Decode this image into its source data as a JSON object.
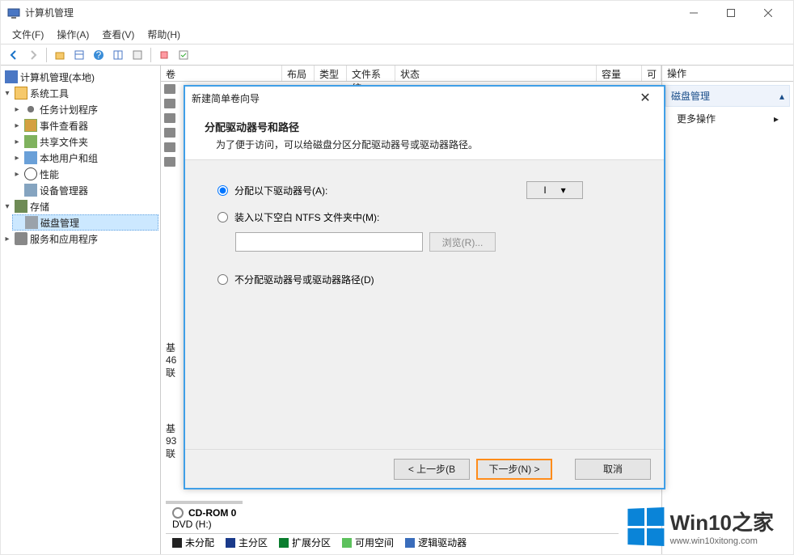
{
  "window": {
    "title": "计算机管理",
    "minimize": "最小化",
    "maximize": "最大化",
    "close": "关闭"
  },
  "menubar": [
    "文件(F)",
    "操作(A)",
    "查看(V)",
    "帮助(H)"
  ],
  "tree": {
    "root": "计算机管理(本地)",
    "system_tools": "系统工具",
    "task_scheduler": "任务计划程序",
    "event_viewer": "事件查看器",
    "shared_folders": "共享文件夹",
    "local_users": "本地用户和组",
    "performance": "性能",
    "device_manager": "设备管理器",
    "storage": "存储",
    "disk_mgmt": "磁盘管理",
    "services_apps": "服务和应用程序"
  },
  "list_headers": {
    "volume": "卷",
    "layout": "布局",
    "type": "类型",
    "filesystem": "文件系统",
    "status": "状态",
    "capacity": "容量",
    "avail": "可",
    "actions": "操作"
  },
  "actions_panel": {
    "title": "磁盘管理",
    "more": "更多操作"
  },
  "wizard": {
    "title": "新建简单卷向导",
    "close": "✕",
    "header": "分配驱动器号和路径",
    "subheader": "为了便于访问，可以给磁盘分区分配驱动器号或驱动器路径。",
    "opt1": "分配以下驱动器号(A):",
    "drive_letter": "I",
    "opt2": "装入以下空白 NTFS 文件夹中(M):",
    "browse": "浏览(R)...",
    "opt3": "不分配驱动器号或驱动器路径(D)",
    "back": "< 上一步(B",
    "next": "下一步(N) >",
    "cancel": "取消"
  },
  "partial_info": {
    "line1a": "基",
    "line2a": "46",
    "line3a": "联",
    "line1b": "基",
    "line2b": "93",
    "line3b": "联"
  },
  "cdrom": {
    "title": "CD-ROM 0",
    "sub": "DVD (H:)"
  },
  "legend": {
    "unalloc": "未分配",
    "primary": "主分区",
    "extended": "扩展分区",
    "free": "可用空间",
    "logical": "逻辑驱动器"
  },
  "watermark": {
    "title": "Win10之家",
    "url": "www.win10xitong.com"
  },
  "colors": {
    "unalloc": "#222222",
    "primary": "#1a3a8a",
    "extended": "#0a7d2e",
    "free": "#5dc15d",
    "logical": "#3a6dbb"
  }
}
